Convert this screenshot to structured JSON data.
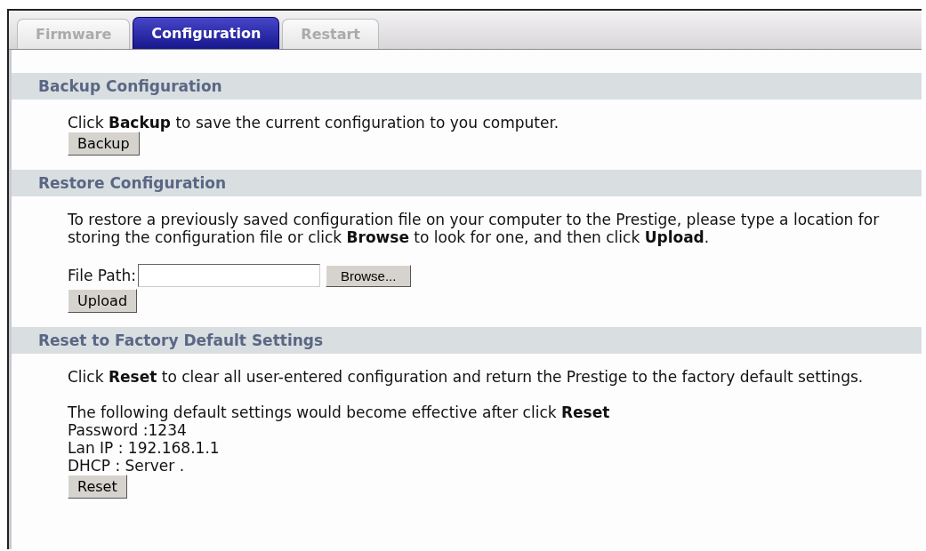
{
  "tabs": [
    {
      "label": "Firmware",
      "selected": false
    },
    {
      "label": "Configuration",
      "selected": true
    },
    {
      "label": "Restart",
      "selected": false
    }
  ],
  "sections": [
    {
      "title": "Backup Configuration",
      "items": [
        {
          "kind": "text",
          "text": "Click **Backup** to save the current configuration to you computer."
        },
        {
          "kind": "button",
          "label": "Backup"
        }
      ]
    },
    {
      "title": "Restore Configuration",
      "items": [
        {
          "kind": "text",
          "text": "To restore a previously saved configuration file on your computer to the Prestige, please type a location for storing the configuration file or click **Browse** to look for one, and then click **Upload**.",
          "gap": true
        },
        {
          "kind": "file",
          "label": "File Path:",
          "button": "Browse..."
        },
        {
          "kind": "button",
          "label": "Upload"
        }
      ]
    },
    {
      "title": "Reset to Factory Default Settings",
      "items": [
        {
          "kind": "text",
          "text": "Click **Reset** to clear all user-entered configuration and return the Prestige to the factory default settings.",
          "gap": true
        },
        {
          "kind": "text",
          "text": "The following default settings would become effective after click **Reset**"
        },
        {
          "kind": "text",
          "text": "Password :1234"
        },
        {
          "kind": "text",
          "text": "Lan IP : 192.168.1.1"
        },
        {
          "kind": "text",
          "text": "DHCP : Server ."
        },
        {
          "kind": "button",
          "label": "Reset"
        }
      ]
    }
  ]
}
